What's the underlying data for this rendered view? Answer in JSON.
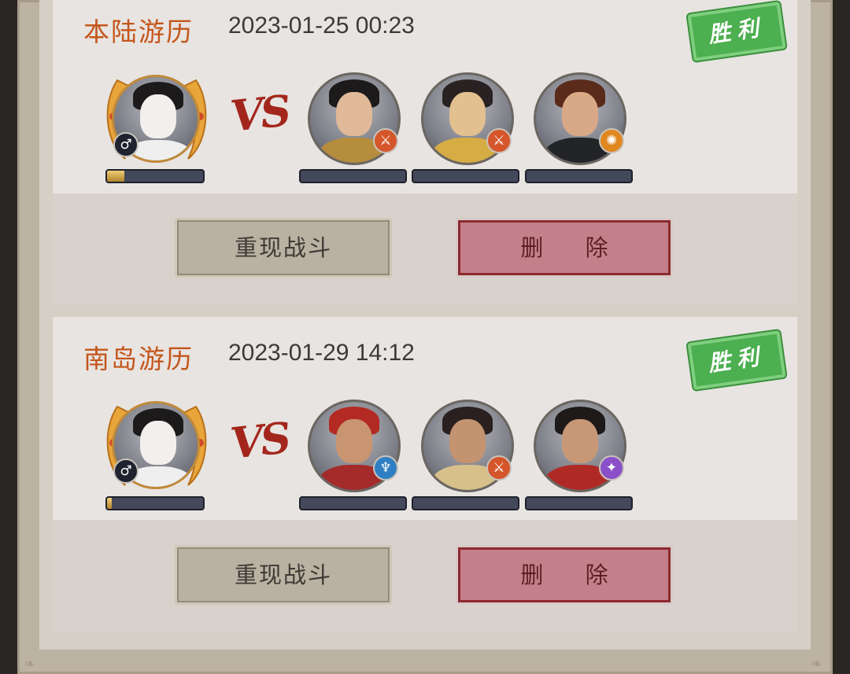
{
  "battles": [
    {
      "title": "本陆游历",
      "time": "2023-01-25 00:23",
      "result": "胜利",
      "player": {
        "gender_icon": "male-icon",
        "gender_symbol": "♂",
        "progress": 0.18
      },
      "vs": "VS",
      "enemies": [
        {
          "class_icon": "sword-icon",
          "class_symbol": "⚔",
          "badge_color": "#d4562a"
        },
        {
          "class_icon": "sword-icon",
          "class_symbol": "⚔",
          "badge_color": "#d4562a"
        },
        {
          "class_icon": "fire-icon",
          "class_symbol": "✺",
          "badge_color": "#e0871f"
        }
      ],
      "replay_label": "重现战斗",
      "delete_label": "删 除"
    },
    {
      "title": "南岛游历",
      "time": "2023-01-29 14:12",
      "result": "胜利",
      "player": {
        "gender_icon": "male-icon",
        "gender_symbol": "♂",
        "progress": 0.05
      },
      "vs": "VS",
      "enemies": [
        {
          "class_icon": "trident-icon",
          "class_symbol": "♆",
          "badge_color": "#2f7fc4"
        },
        {
          "class_icon": "sword-icon",
          "class_symbol": "⚔",
          "badge_color": "#d4562a"
        },
        {
          "class_icon": "magic-icon",
          "class_symbol": "✦",
          "badge_color": "#8a4fc9"
        }
      ],
      "replay_label": "重现战斗",
      "delete_label": "删 除"
    }
  ],
  "colors": {
    "title": "#c4561c",
    "stamp": "#4caf50",
    "vs": "#a3261c",
    "delete_button": "#c3808a",
    "replay_button": "#b9b1a1"
  }
}
